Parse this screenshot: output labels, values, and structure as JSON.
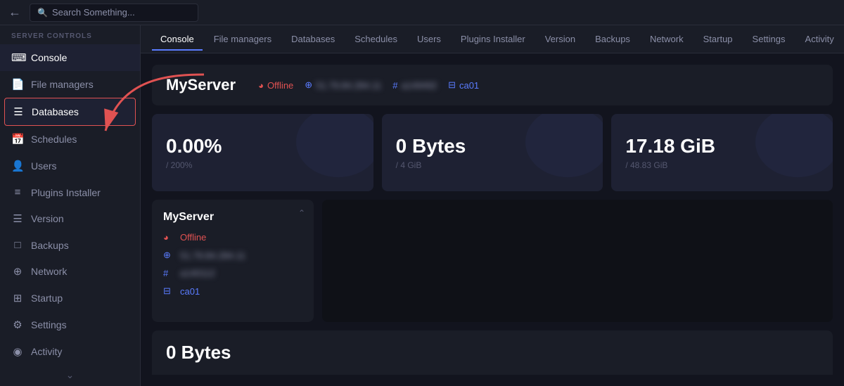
{
  "topbar": {
    "back_icon": "←",
    "search_placeholder": "Search Something...",
    "search_icon": "🔍"
  },
  "sidebar": {
    "section_label": "SERVER CONTROLS",
    "items": [
      {
        "id": "console",
        "label": "Console",
        "icon": "⌨",
        "active": true,
        "highlighted": false
      },
      {
        "id": "file-managers",
        "label": "File managers",
        "icon": "📄",
        "active": false,
        "highlighted": false
      },
      {
        "id": "databases",
        "label": "Databases",
        "icon": "☰",
        "active": false,
        "highlighted": true
      },
      {
        "id": "schedules",
        "label": "Schedules",
        "icon": "📅",
        "active": false,
        "highlighted": false
      },
      {
        "id": "users",
        "label": "Users",
        "icon": "👤",
        "active": false,
        "highlighted": false
      },
      {
        "id": "plugins-installer",
        "label": "Plugins Installer",
        "icon": "≡",
        "active": false,
        "highlighted": false
      },
      {
        "id": "version",
        "label": "Version",
        "icon": "☰",
        "active": false,
        "highlighted": false
      },
      {
        "id": "backups",
        "label": "Backups",
        "icon": "□",
        "active": false,
        "highlighted": false
      },
      {
        "id": "network",
        "label": "Network",
        "icon": "⊕",
        "active": false,
        "highlighted": false
      },
      {
        "id": "startup",
        "label": "Startup",
        "icon": "⊞",
        "active": false,
        "highlighted": false
      },
      {
        "id": "settings",
        "label": "Settings",
        "icon": "⚙",
        "active": false,
        "highlighted": false
      },
      {
        "id": "activity",
        "label": "Activity",
        "icon": "◉",
        "active": false,
        "highlighted": false
      }
    ]
  },
  "tabs": [
    {
      "id": "console",
      "label": "Console",
      "active": true
    },
    {
      "id": "file-managers",
      "label": "File managers",
      "active": false
    },
    {
      "id": "databases",
      "label": "Databases",
      "active": false
    },
    {
      "id": "schedules",
      "label": "Schedules",
      "active": false
    },
    {
      "id": "users",
      "label": "Users",
      "active": false
    },
    {
      "id": "plugins-installer",
      "label": "Plugins Installer",
      "active": false
    },
    {
      "id": "version",
      "label": "Version",
      "active": false
    },
    {
      "id": "backups",
      "label": "Backups",
      "active": false
    },
    {
      "id": "network",
      "label": "Network",
      "active": false
    },
    {
      "id": "startup",
      "label": "Startup",
      "active": false
    },
    {
      "id": "settings",
      "label": "Settings",
      "active": false
    },
    {
      "id": "activity",
      "label": "Activity",
      "active": false
    }
  ],
  "server_header": {
    "name": "MyServer",
    "status": "Offline",
    "ip_blurred": "51.79.84.284.11",
    "hash_blurred": "a149492",
    "location": "ca01"
  },
  "stats": [
    {
      "id": "cpu",
      "value": "0.00%",
      "sub": "/ 200%"
    },
    {
      "id": "memory",
      "value": "0 Bytes",
      "sub": "/ 4 GiB"
    },
    {
      "id": "disk",
      "value": "17.18 GiB",
      "sub": "/ 48.83 GiB"
    }
  ],
  "server_detail": {
    "name": "MyServer",
    "status": "Offline",
    "ip_blurred": "51.79.84.284.11",
    "hash_blurred": "a140112",
    "location": "ca01"
  },
  "bottom_stat": {
    "value": "0 Bytes"
  }
}
